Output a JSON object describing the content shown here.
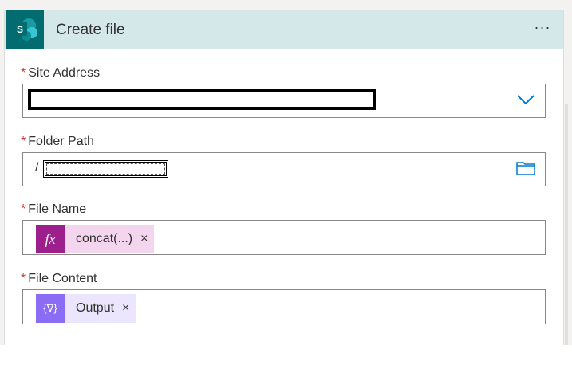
{
  "card": {
    "title": "Create file",
    "app_icon_letter": "S",
    "more_label": "···"
  },
  "fields": {
    "site_address": {
      "required": "*",
      "label": "Site Address"
    },
    "folder_path": {
      "required": "*",
      "label": "Folder Path",
      "prefix": "/"
    },
    "file_name": {
      "required": "*",
      "label": "File Name",
      "token_label": "concat(...)",
      "token_icon": "fx",
      "remove": "×"
    },
    "file_content": {
      "required": "*",
      "label": "File Content",
      "token_label": "Output",
      "token_icon": "{∇}",
      "remove": "×"
    }
  },
  "colors": {
    "header_bg": "#d5e8e9",
    "sharepoint_teal": "#036c70",
    "expression_token": "#9c1f8c",
    "expression_token_bg": "#f3d6ee",
    "variable_token": "#8b6cf5",
    "variable_token_bg": "#ebe6fd",
    "accent_blue": "#0078d4",
    "required_red": "#d13438"
  }
}
